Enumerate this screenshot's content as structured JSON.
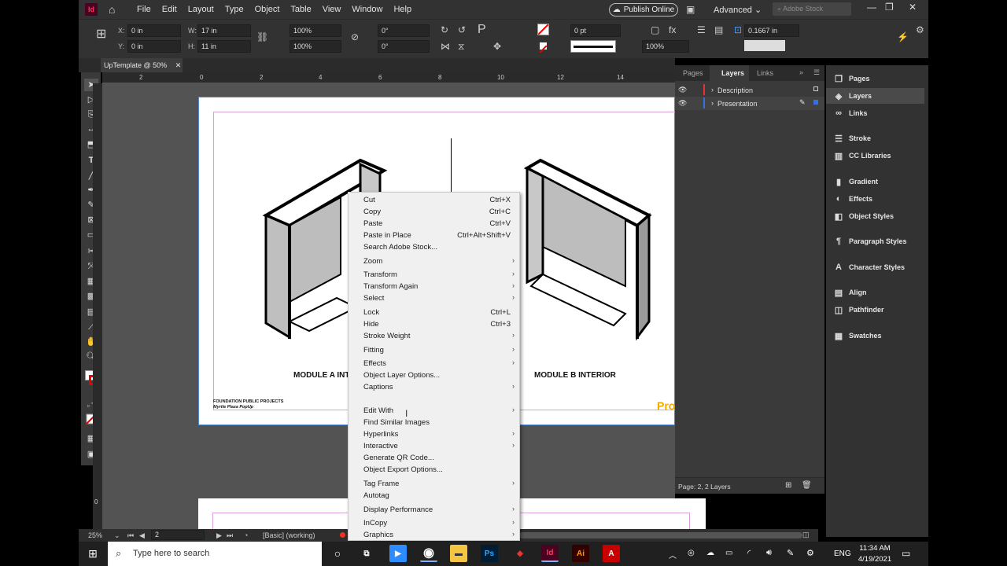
{
  "app": {
    "logo": "Id",
    "menu": [
      "File",
      "Edit",
      "Layout",
      "Type",
      "Object",
      "Table",
      "View",
      "Window",
      "Help"
    ],
    "publish": "Publish Online",
    "workspace": "Advanced",
    "stock_placeholder": "Adobe Stock"
  },
  "control": {
    "x_label": "X:",
    "x_value": "0 in",
    "y_label": "Y:",
    "y_value": "0 in",
    "w_label": "W:",
    "w_value": "17 in",
    "h_label": "H:",
    "h_value": "11 in",
    "scale_x": "100%",
    "scale_y": "100%",
    "rotate": "0°",
    "shear": "0°",
    "stroke_weight": "0 pt",
    "opacity": "100%",
    "offset": "0.1667 in"
  },
  "doc_tab": {
    "title": "UpTemplate @ 50%"
  },
  "ruler": {
    "h_ticks": [
      "2",
      "0",
      "2",
      "4",
      "6",
      "8",
      "10",
      "12",
      "14"
    ],
    "v_ticks": [
      "0"
    ]
  },
  "page": {
    "module_a": "MODULE A INTERIOR",
    "module_b": "MODULE B INTERIOR",
    "footer1": "FOUNDATION PUBLIC PROJECTS",
    "footer2": "Myrtle Plaza PopUp",
    "brand": "Pro"
  },
  "status": {
    "zoom": "25%",
    "page": "2",
    "style": "[Basic] (working)"
  },
  "layers_panel": {
    "tabs": [
      "Pages",
      "Layers",
      "Links"
    ],
    "layers": [
      {
        "name": "Description",
        "color": "#e53232"
      },
      {
        "name": "Presentation",
        "color": "#3a6ed8"
      }
    ],
    "footer": "Page: 2, 2 Layers"
  },
  "dock": [
    "Pages",
    "Layers",
    "Links",
    "Stroke",
    "CC Libraries",
    "Gradient",
    "Effects",
    "Object Styles",
    "Paragraph Styles",
    "Character Styles",
    "Align",
    "Pathfinder",
    "Swatches"
  ],
  "context_menu": [
    {
      "label": "Cut",
      "shortcut": "Ctrl+X"
    },
    {
      "label": "Copy",
      "shortcut": "Ctrl+C"
    },
    {
      "label": "Paste",
      "shortcut": "Ctrl+V"
    },
    {
      "label": "Paste in Place",
      "shortcut": "Ctrl+Alt+Shift+V"
    },
    {
      "label": "Search Adobe Stock...",
      "shortcut": ""
    },
    {
      "label": "Zoom",
      "sub": true
    },
    {
      "label": "Transform",
      "sub": true
    },
    {
      "label": "Transform Again",
      "sub": true
    },
    {
      "label": "Select",
      "sub": true
    },
    {
      "label": "Lock",
      "shortcut": "Ctrl+L"
    },
    {
      "label": "Hide",
      "shortcut": "Ctrl+3"
    },
    {
      "label": "Stroke Weight",
      "sub": true
    },
    {
      "label": "Fitting",
      "sub": true
    },
    {
      "label": "Effects",
      "sub": true
    },
    {
      "label": "Object Layer Options...",
      "shortcut": ""
    },
    {
      "label": "Captions",
      "sub": true
    },
    {
      "label": "Edit With",
      "sub": true
    },
    {
      "label": "Find Similar Images",
      "shortcut": ""
    },
    {
      "label": "Hyperlinks",
      "sub": true
    },
    {
      "label": "Interactive",
      "sub": true
    },
    {
      "label": "Generate QR Code...",
      "shortcut": ""
    },
    {
      "label": "Object Export Options...",
      "shortcut": ""
    },
    {
      "label": "Tag Frame",
      "sub": true
    },
    {
      "label": "Autotag",
      "shortcut": ""
    },
    {
      "label": "Display Performance",
      "sub": true
    },
    {
      "label": "InCopy",
      "sub": true
    },
    {
      "label": "Graphics",
      "sub": true
    }
  ],
  "taskbar": {
    "search_placeholder": "Type here to search",
    "lang": "ENG",
    "time": "11:34 AM",
    "date": "4/19/2021"
  }
}
